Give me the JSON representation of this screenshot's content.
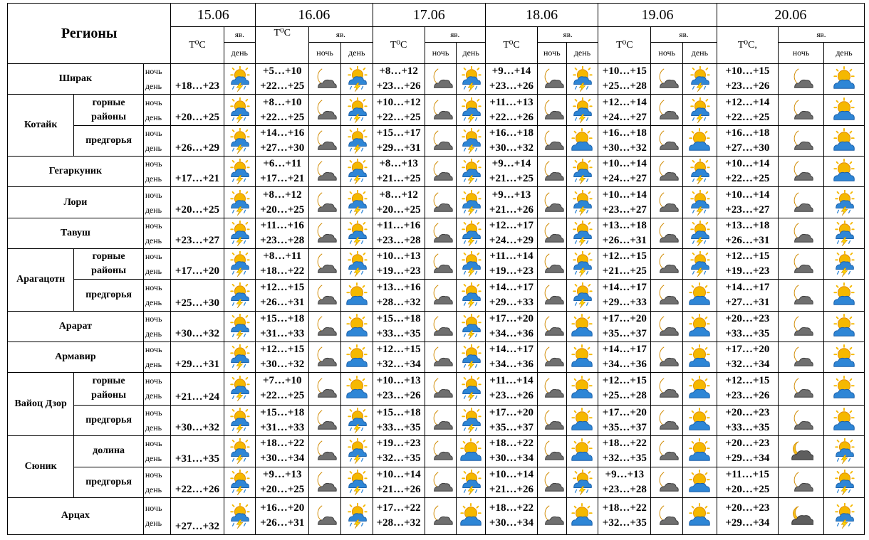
{
  "header": {
    "regions_label": "Регионы",
    "temp_label": "T⁰C",
    "temp_label_last": "T⁰C,",
    "yav_label": "яв.",
    "night_label": "ночь",
    "day_label": "день",
    "dates": [
      "15.06",
      "16.06",
      "17.06",
      "18.06",
      "19.06",
      "20.06"
    ]
  },
  "row_labels": {
    "night": "ночь",
    "day": "день"
  },
  "groups": [
    {
      "region": "Ширак",
      "subs": null
    },
    {
      "region": "Котайк",
      "subs": [
        "горные районы",
        "предгорья"
      ]
    },
    {
      "region": "Гегаркуник",
      "subs": null
    },
    {
      "region": "Лори",
      "subs": null
    },
    {
      "region": "Тавуш",
      "subs": null
    },
    {
      "region": "Арагацотн",
      "subs": [
        "горные районы",
        "предгорья"
      ]
    },
    {
      "region": "Арарат",
      "subs": null
    },
    {
      "region": "Армавир",
      "subs": null
    },
    {
      "region": "Вайоц Дзор",
      "subs": [
        "горные районы",
        "предгорья"
      ]
    },
    {
      "region": "Сюник",
      "subs": [
        "долина",
        "предгорья"
      ]
    },
    {
      "region": "Арцах",
      "subs": null
    }
  ],
  "forecast": [
    {
      "d1": "+18…+23",
      "d1i": "sun-storm",
      "days": [
        {
          "n": "+5…+10",
          "d": "+22…+25",
          "ni": "moon-cloud",
          "di": "sun-storm"
        },
        {
          "n": "+8…+12",
          "d": "+23…+26",
          "ni": "moon-cloud",
          "di": "sun-storm"
        },
        {
          "n": "+9…+14",
          "d": "+23…+26",
          "ni": "moon-cloud",
          "di": "sun-storm"
        },
        {
          "n": "+10…+15",
          "d": "+25…+28",
          "ni": "moon-cloud",
          "di": "sun-storm"
        },
        {
          "n": "+10…+15",
          "d": "+23…+26",
          "ni": "moon-cloud",
          "di": "sun-cloud"
        }
      ]
    },
    {
      "d1": "+20…+25",
      "d1i": "sun-storm",
      "days": [
        {
          "n": "+8…+10",
          "d": "+22…+25",
          "ni": "moon-cloud",
          "di": "sun-storm"
        },
        {
          "n": "+10…+12",
          "d": "+22…+25",
          "ni": "moon-cloud",
          "di": "sun-storm"
        },
        {
          "n": "+11…+13",
          "d": "+22…+26",
          "ni": "moon-cloud",
          "di": "sun-storm"
        },
        {
          "n": "+12…+14",
          "d": "+24…+27",
          "ni": "moon-cloud",
          "di": "sun-storm"
        },
        {
          "n": "+12…+14",
          "d": "+22…+25",
          "ni": "moon-cloud",
          "di": "sun-cloud"
        }
      ]
    },
    {
      "d1": "+26…+29",
      "d1i": "sun-storm",
      "days": [
        {
          "n": "+14…+16",
          "d": "+27…+30",
          "ni": "moon-cloud",
          "di": "sun-storm"
        },
        {
          "n": "+15…+17",
          "d": "+29…+31",
          "ni": "moon-cloud",
          "di": "sun-storm"
        },
        {
          "n": "+16…+18",
          "d": "+30…+32",
          "ni": "moon-cloud",
          "di": "sun-cloud"
        },
        {
          "n": "+16…+18",
          "d": "+30…+32",
          "ni": "moon-cloud",
          "di": "sun-cloud"
        },
        {
          "n": "+16…+18",
          "d": "+27…+30",
          "ni": "moon-cloud",
          "di": "sun-cloud"
        }
      ]
    },
    {
      "d1": "+17…+21",
      "d1i": "sun-storm",
      "days": [
        {
          "n": "+6…+11",
          "d": "+17…+21",
          "ni": "moon-cloud",
          "di": "sun-storm"
        },
        {
          "n": "+8…+13",
          "d": "+21…+25",
          "ni": "moon-cloud",
          "di": "sun-storm"
        },
        {
          "n": "+9…+14",
          "d": "+21…+25",
          "ni": "moon-cloud",
          "di": "sun-storm"
        },
        {
          "n": "+10…+14",
          "d": "+24…+27",
          "ni": "moon-cloud",
          "di": "sun-storm"
        },
        {
          "n": "+10…+14",
          "d": "+22…+25",
          "ni": "moon-cloud",
          "di": "sun-cloud"
        }
      ]
    },
    {
      "d1": "+20…+25",
      "d1i": "sun-storm",
      "days": [
        {
          "n": "+8…+12",
          "d": "+20…+25",
          "ni": "moon-cloud",
          "di": "sun-storm"
        },
        {
          "n": "+8…+12",
          "d": "+20…+25",
          "ni": "moon-cloud",
          "di": "sun-storm"
        },
        {
          "n": "+9…+13",
          "d": "+21…+26",
          "ni": "moon-cloud",
          "di": "sun-storm"
        },
        {
          "n": "+10…+14",
          "d": "+23…+27",
          "ni": "moon-cloud",
          "di": "sun-storm"
        },
        {
          "n": "+10…+14",
          "d": "+23…+27",
          "ni": "moon-cloud",
          "di": "sun-storm"
        }
      ]
    },
    {
      "d1": "+23…+27",
      "d1i": "sun-storm",
      "days": [
        {
          "n": "+11…+16",
          "d": "+23…+28",
          "ni": "moon-cloud",
          "di": "sun-storm"
        },
        {
          "n": "+11…+16",
          "d": "+23…+28",
          "ni": "moon-cloud",
          "di": "sun-storm"
        },
        {
          "n": "+12…+17",
          "d": "+24…+29",
          "ni": "moon-cloud",
          "di": "sun-storm"
        },
        {
          "n": "+13…+18",
          "d": "+26…+31",
          "ni": "moon-cloud",
          "di": "sun-storm"
        },
        {
          "n": "+13…+18",
          "d": "+26…+31",
          "ni": "moon-cloud",
          "di": "sun-storm"
        }
      ]
    },
    {
      "d1": "+17…+20",
      "d1i": "sun-storm",
      "days": [
        {
          "n": "+8…+11",
          "d": "+18…+22",
          "ni": "moon-cloud",
          "di": "sun-storm"
        },
        {
          "n": "+10…+13",
          "d": "+19…+23",
          "ni": "moon-cloud",
          "di": "sun-storm"
        },
        {
          "n": "+11…+14",
          "d": "+19…+23",
          "ni": "moon-cloud",
          "di": "sun-storm"
        },
        {
          "n": "+12…+15",
          "d": "+21…+25",
          "ni": "moon-cloud",
          "di": "sun-storm"
        },
        {
          "n": "+12…+15",
          "d": "+19…+23",
          "ni": "moon-cloud",
          "di": "sun-storm"
        }
      ]
    },
    {
      "d1": "+25…+30",
      "d1i": "sun-storm",
      "days": [
        {
          "n": "+12…+15",
          "d": "+26…+31",
          "ni": "moon-cloud",
          "di": "sun-cloud"
        },
        {
          "n": "+13…+16",
          "d": "+28…+32",
          "ni": "moon-cloud",
          "di": "sun-storm"
        },
        {
          "n": "+14…+17",
          "d": "+29…+33",
          "ni": "moon-cloud",
          "di": "sun-storm"
        },
        {
          "n": "+14…+17",
          "d": "+29…+33",
          "ni": "moon-cloud",
          "di": "sun-cloud"
        },
        {
          "n": "+14…+17",
          "d": "+27…+31",
          "ni": "moon-cloud",
          "di": "sun-cloud"
        }
      ]
    },
    {
      "d1": "+30…+32",
      "d1i": "sun-storm",
      "days": [
        {
          "n": "+15…+18",
          "d": "+31…+33",
          "ni": "moon-cloud",
          "di": "sun-cloud"
        },
        {
          "n": "+15…+18",
          "d": "+33…+35",
          "ni": "moon-cloud",
          "di": "sun-storm"
        },
        {
          "n": "+17…+20",
          "d": "+34…+36",
          "ni": "moon-cloud",
          "di": "sun-cloud"
        },
        {
          "n": "+17…+20",
          "d": "+35…+37",
          "ni": "moon-cloud",
          "di": "sun-cloud"
        },
        {
          "n": "+20…+23",
          "d": "+33…+35",
          "ni": "moon-cloud",
          "di": "sun-cloud"
        }
      ]
    },
    {
      "d1": "+29…+31",
      "d1i": "sun-storm",
      "days": [
        {
          "n": "+12…+15",
          "d": "+30…+32",
          "ni": "moon-cloud",
          "di": "sun-cloud"
        },
        {
          "n": "+12…+15",
          "d": "+32…+34",
          "ni": "moon-cloud",
          "di": "sun-storm"
        },
        {
          "n": "+14…+17",
          "d": "+34…+36",
          "ni": "moon-cloud",
          "di": "sun-cloud"
        },
        {
          "n": "+14…+17",
          "d": "+34…+36",
          "ni": "moon-cloud",
          "di": "sun-cloud"
        },
        {
          "n": "+17…+20",
          "d": "+32…+34",
          "ni": "moon-cloud",
          "di": "sun-cloud"
        }
      ]
    },
    {
      "d1": "+21…+24",
      "d1i": "sun-storm",
      "days": [
        {
          "n": "+7…+10",
          "d": "+22…+25",
          "ni": "moon-cloud",
          "di": "sun-cloud"
        },
        {
          "n": "+10…+13",
          "d": "+23…+26",
          "ni": "moon-cloud",
          "di": "sun-storm"
        },
        {
          "n": "+11…+14",
          "d": "+23…+26",
          "ni": "moon-cloud",
          "di": "sun-cloud"
        },
        {
          "n": "+12…+15",
          "d": "+25…+28",
          "ni": "moon-cloud",
          "di": "sun-cloud"
        },
        {
          "n": "+12…+15",
          "d": "+23…+26",
          "ni": "moon-cloud",
          "di": "sun-cloud"
        }
      ]
    },
    {
      "d1": "+30…+32",
      "d1i": "sun-storm",
      "days": [
        {
          "n": "+15…+18",
          "d": "+31…+33",
          "ni": "moon-cloud",
          "di": "sun-storm"
        },
        {
          "n": "+15…+18",
          "d": "+33…+35",
          "ni": "moon-cloud",
          "di": "sun-storm"
        },
        {
          "n": "+17…+20",
          "d": "+35…+37",
          "ni": "moon-cloud",
          "di": "sun-cloud"
        },
        {
          "n": "+17…+20",
          "d": "+35…+37",
          "ni": "moon-cloud",
          "di": "sun-cloud"
        },
        {
          "n": "+20…+23",
          "d": "+33…+35",
          "ni": "moon-cloud",
          "di": "sun-cloud"
        }
      ]
    },
    {
      "d1": "+31…+35",
      "d1i": "sun-storm",
      "days": [
        {
          "n": "+18…+22",
          "d": "+30…+34",
          "ni": "moon-cloud",
          "di": "sun-storm"
        },
        {
          "n": "+19…+23",
          "d": "+32…+35",
          "ni": "moon-cloud",
          "di": "sun-cloud"
        },
        {
          "n": "+18…+22",
          "d": "+30…+34",
          "ni": "moon-cloud",
          "di": "sun-cloud"
        },
        {
          "n": "+18…+22",
          "d": "+32…+35",
          "ni": "moon-cloud",
          "di": "sun-cloud"
        },
        {
          "n": "+20…+23",
          "d": "+29…+34",
          "ni": "cloud-dark",
          "di": "sun-storm"
        }
      ]
    },
    {
      "d1": "+22…+26",
      "d1i": "sun-storm",
      "days": [
        {
          "n": "+9…+13",
          "d": "+20…+25",
          "ni": "moon-cloud",
          "di": "sun-storm"
        },
        {
          "n": "+10…+14",
          "d": "+21…+26",
          "ni": "moon-cloud",
          "di": "sun-storm"
        },
        {
          "n": "+10…+14",
          "d": "+21…+26",
          "ni": "moon-cloud",
          "di": "sun-storm"
        },
        {
          "n": "+9…+13",
          "d": "+23…+28",
          "ni": "moon-cloud",
          "di": "sun-cloud"
        },
        {
          "n": "+11…+15",
          "d": "+20…+25",
          "ni": "moon-cloud",
          "di": "sun-storm"
        }
      ]
    },
    {
      "d1": "+27…+32",
      "d1i": "sun-storm",
      "days": [
        {
          "n": "+16…+20",
          "d": "+26…+31",
          "ni": "moon-cloud",
          "di": "sun-storm"
        },
        {
          "n": "+17…+22",
          "d": "+28…+32",
          "ni": "moon-cloud",
          "di": "sun-cloud"
        },
        {
          "n": "+18…+22",
          "d": "+30…+34",
          "ni": "moon-cloud",
          "di": "sun-cloud"
        },
        {
          "n": "+18…+22",
          "d": "+32…+35",
          "ni": "moon-cloud",
          "di": "sun-cloud"
        },
        {
          "n": "+20…+23",
          "d": "+29…+34",
          "ni": "cloud-dark",
          "di": "sun-storm"
        }
      ]
    }
  ]
}
